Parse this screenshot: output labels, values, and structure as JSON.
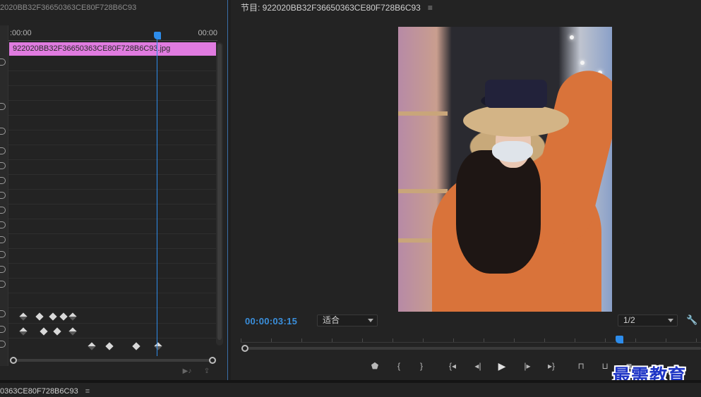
{
  "effect_controls": {
    "tab_title": "2020BB32F36650363CE80F728B6C93",
    "ruler_start": ":00:00",
    "ruler_end": "00:00",
    "clip_name": "922020BB32F36650363CE80F728B6C93.jpg"
  },
  "program_monitor": {
    "tab_title": "节目: 922020BB32F36650363CE80F728B6C93",
    "menu_glyph": "≡",
    "timecode": "00:00:03:15",
    "zoom_select": "适合",
    "resolution_select": "1/2"
  },
  "timeline_tab": {
    "title": "0363CE80F728B6C93",
    "menu_glyph": "≡"
  },
  "watermark": "最需教育",
  "icons": {
    "wrench": "wrench-icon",
    "marker": "marker-icon",
    "mark_in": "mark-in-icon",
    "mark_out": "mark-out-icon",
    "go_to_in": "go-to-in-icon",
    "step_back": "step-back-icon",
    "play": "play-icon",
    "step_forward": "step-forward-icon",
    "go_to_out": "go-to-out-icon",
    "lift": "lift-icon",
    "extract": "extract-icon",
    "export_frame": "camera-icon"
  },
  "colors": {
    "accent_blue": "#2d8ceb",
    "timecode_blue": "#3a8fdc",
    "clip_pink": "#e07be0",
    "watermark_blue": "#1f35c6"
  }
}
